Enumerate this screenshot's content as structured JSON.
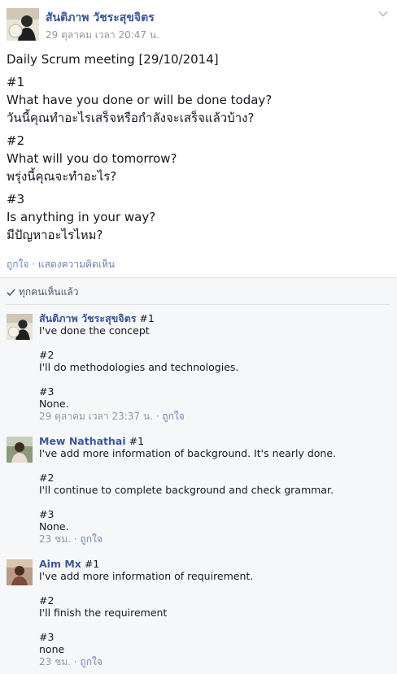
{
  "post": {
    "author": "สันติภาพ วัชระสุขจิตร",
    "time": "29 ตุลาคม เวลา 20:47 น.",
    "lines": [
      "Daily Scrum meeting [29/10/2014]",
      "#1",
      "What have you done or will be done today?",
      "วันนี้คุณทำอะไรเสร็จหรือกำลังจะเสร็จแล้วบ้าง?",
      "#2",
      "What will you do tomorrow?",
      "พรุ่งนี้คุณจะทำอะไร?",
      "#3",
      "Is anything in your way?",
      "มีปัญหาอะไรไหม?"
    ],
    "like_label": "ถูกใจ",
    "separator": "·",
    "comment_label": "แสดงความคิดเห็น"
  },
  "seen_label": "ทุกคนเห็นแล้ว",
  "comments": [
    {
      "author": "สันติภาพ วัชระสุขจิตร",
      "first": "#1",
      "lines": [
        "I've done the concept",
        "",
        "#2",
        "I'll do methodologies and technologies.",
        "",
        "#3",
        "None."
      ],
      "time": "29 ตุลาคม เวลา 23:37 น.",
      "like_label": "ถูกใจ"
    },
    {
      "author": "Mew Nathathai",
      "first": "#1",
      "lines": [
        "I've add more information of background. It's nearly done.",
        "",
        "#2",
        "I'll continue to complete background and check grammar.",
        "",
        "#3",
        "None."
      ],
      "time": "23 ชม.",
      "like_label": "ถูกใจ"
    },
    {
      "author": "Aim Mx",
      "first": "#1",
      "lines": [
        "I've add more information of requirement.",
        "",
        "#2",
        "I'll finish the requirement",
        "",
        "#3",
        "none"
      ],
      "time": "23 ชม.",
      "like_label": "ถูกใจ"
    }
  ],
  "colors": {
    "link": "#3b5998",
    "meta": "#9197a3",
    "comments_bg": "#f6f7f9"
  }
}
